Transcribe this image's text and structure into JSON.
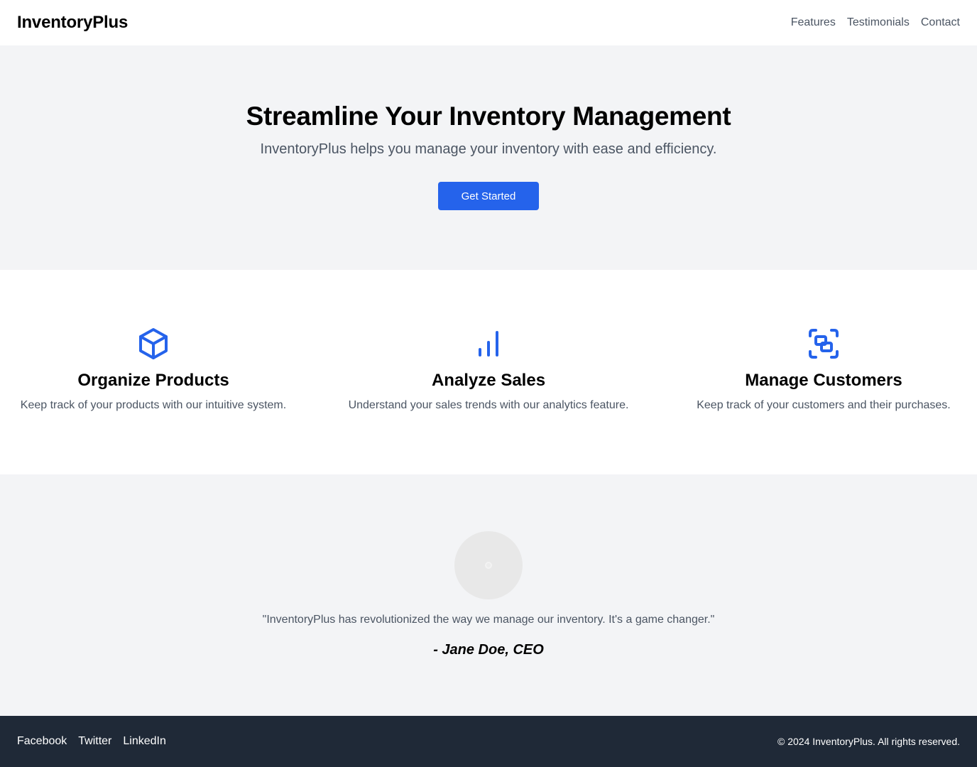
{
  "header": {
    "brand": "InventoryPlus",
    "nav": [
      "Features",
      "Testimonials",
      "Contact"
    ]
  },
  "hero": {
    "title": "Streamline Your Inventory Management",
    "subtitle": "InventoryPlus helps you manage your inventory with ease and efficiency.",
    "cta_label": "Get Started"
  },
  "features": [
    {
      "icon": "cube-icon",
      "title": "Organize Products",
      "description": "Keep track of your products with our intuitive system."
    },
    {
      "icon": "bar-chart-icon",
      "title": "Analyze Sales",
      "description": "Understand your sales trends with our analytics feature."
    },
    {
      "icon": "group-objects-icon",
      "title": "Manage Customers",
      "description": "Keep track of your customers and their purchases."
    }
  ],
  "testimonial": {
    "avatar": "avatar-placeholder",
    "quote": "\"InventoryPlus has revolutionized the way we manage our inventory. It's a game changer.\"",
    "author": "- Jane Doe, CEO"
  },
  "footer": {
    "social": [
      "Facebook",
      "Twitter",
      "LinkedIn"
    ],
    "copyright": "© 2024 InventoryPlus. All rights reserved."
  },
  "colors": {
    "accent": "#2563eb",
    "section_bg": "#f3f4f6",
    "footer_bg": "#1f2937",
    "muted_text": "#4b5563"
  }
}
